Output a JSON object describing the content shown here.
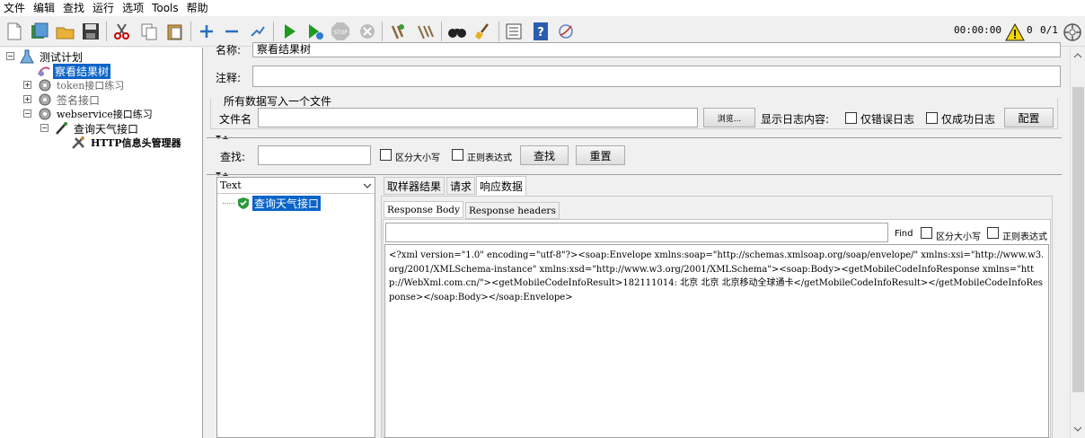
{
  "menu": [
    "文件",
    "编辑",
    "查找",
    "运行",
    "选项",
    "Tools",
    "帮助"
  ],
  "toolbar": {
    "timer": "00:00:00",
    "warning_count": "0",
    "threads": "0/1"
  },
  "tree": {
    "root": "测试计划",
    "items": [
      {
        "label": "察看结果树",
        "selected": true
      },
      {
        "label": "token接口练习"
      },
      {
        "label": "签名接口"
      },
      {
        "label": "webservice接口练习"
      },
      {
        "label": "查询天气接口"
      },
      {
        "label": "HTTP信息头管理器"
      }
    ]
  },
  "form": {
    "name_label": "名称:",
    "name_value": "察看结果树",
    "comment_label": "注释:",
    "section_title": "所有数据写入一个文件",
    "filename_label": "文件名",
    "browse_button": "浏览...",
    "log_label": "显示日志内容:",
    "errors_only": "仅错误日志",
    "success_only": "仅成功日志",
    "configure_button": "配置"
  },
  "search": {
    "label": "查找:",
    "case_sensitive": "区分大小写",
    "regex": "正则表达式",
    "find_button": "查找",
    "reset_button": "重置"
  },
  "results": {
    "renderer": "Text",
    "sample_label": "查询天气接口",
    "tabs": [
      "取样器结果",
      "请求",
      "响应数据"
    ],
    "subtabs": [
      "Response Body",
      "Response headers"
    ],
    "find_label": "Find",
    "find_case": "区分大小写",
    "find_regex": "正则表达式",
    "response_body": "<?xml version=\"1.0\" encoding=\"utf-8\"?><soap:Envelope xmlns:soap=\"http://schemas.xmlsoap.org/soap/envelope/\" xmlns:xsi=\"http://www.w3.org/2001/XMLSchema-instance\" xmlns:xsd=\"http://www.w3.org/2001/XMLSchema\"><soap:Body><getMobileCodeInfoResponse xmlns=\"http://WebXml.com.cn/\"><getMobileCodeInfoResult>182111014: 北京 北京 北京移动全球通卡</getMobileCodeInfoResult></getMobileCodeInfoResponse></soap:Body></soap:Envelope>"
  },
  "colors": {
    "selection": "#0b64c8",
    "run_green": "#1e9b1e",
    "warning_yellow": "#f5d400"
  }
}
